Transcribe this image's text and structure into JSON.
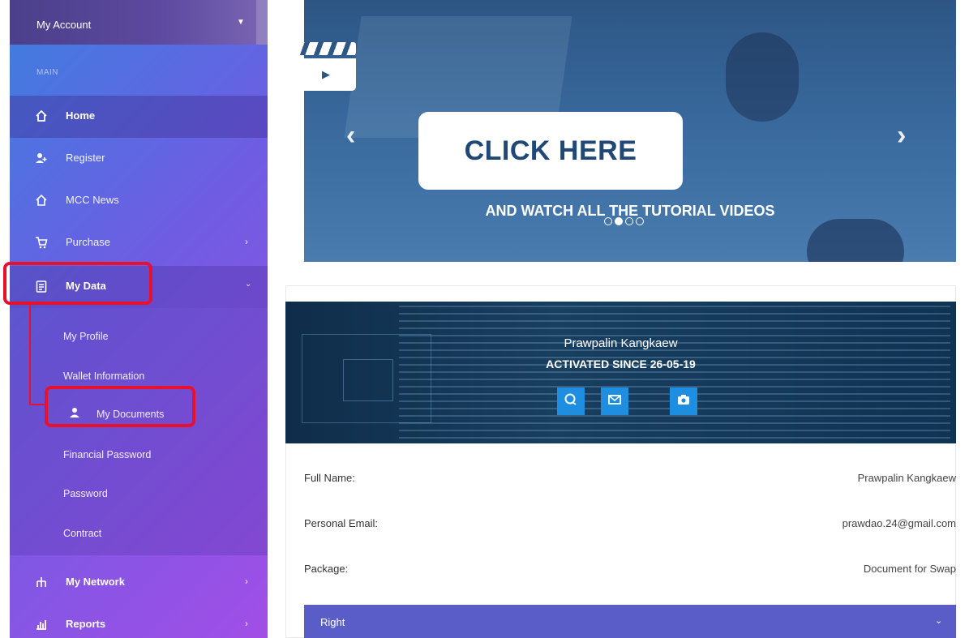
{
  "account": {
    "label": "My Account",
    "chevron": "chevron-down-icon"
  },
  "sidebar": {
    "section_label": "MAIN",
    "items": [
      {
        "label": "Home",
        "icon": "home-icon"
      },
      {
        "label": "Register",
        "icon": "user-add-icon"
      },
      {
        "label": "MCC News",
        "icon": "home-icon"
      },
      {
        "label": "Purchase",
        "icon": "cart-icon"
      },
      {
        "label": "My Data",
        "icon": "clipboard-icon"
      },
      {
        "label": "My Network",
        "icon": "network-icon"
      },
      {
        "label": "Reports",
        "icon": "chart-icon"
      }
    ],
    "submenu": [
      {
        "label": "My Profile"
      },
      {
        "label": "Wallet Information"
      },
      {
        "label": "My Documents",
        "icon": "user-icon"
      },
      {
        "label": "Financial Password"
      },
      {
        "label": "Password"
      },
      {
        "label": "Contract"
      }
    ]
  },
  "banner": {
    "cta_label": "CLICK HERE",
    "subtitle": "AND WATCH ALL THE TUTORIAL VIDEOS",
    "slide_count": 4,
    "active_slide": 2
  },
  "profile": {
    "name": "Prawpalin Kangkaew",
    "activated": "ACTIVATED SINCE 26-05-19",
    "actions": [
      "chat-icon",
      "mail-icon",
      "camera-icon"
    ],
    "fields": [
      {
        "label": "Full Name:",
        "value": "Prawpalin Kangkaew"
      },
      {
        "label": "Personal Email:",
        "value": "prawdao.24@gmail.com"
      },
      {
        "label": "Package:",
        "value": "Document for Swap"
      }
    ]
  },
  "accordion": {
    "label": "Right"
  },
  "colors": {
    "highlight": "#e8112d",
    "accent": "#5a5cc7",
    "action": "#1e8ee0"
  }
}
